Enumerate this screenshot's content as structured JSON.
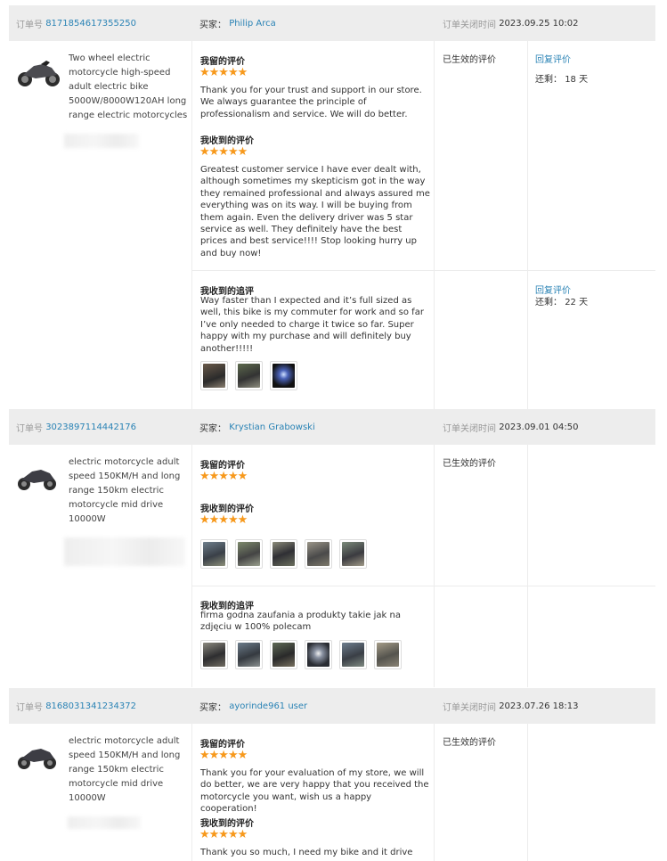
{
  "labels": {
    "order_no": "订单号",
    "buyer": "买家：",
    "closed": "订单关闭时间",
    "my_review": "我留的评价",
    "received_review": "我收到的评价",
    "received_followup": "我收到的追评",
    "effective": "已生效的评价",
    "reply": "回复评价",
    "remaining": "还剩：",
    "days": "天",
    "stars": "★★★★★"
  },
  "orders": [
    {
      "order_id": "8171854617355250",
      "buyer": "Philip Arca",
      "closed_time": "2023.09.25 10:02",
      "product": "Two wheel electric motorcycle high-speed adult electric bike 5000W/8000W120AH long range electric motorcycles",
      "my_review_text": "Thank you for your trust and support in our store. We always guarantee the principle of professionalism and service. We will do better.",
      "received_review_text": "Greatest customer service I have ever dealt with, although sometimes my skepticism got in the way they remained professional and always assured me everything was on its way. I will be buying from them again. Even the delivery driver was 5 star service as well. They definitely have the best prices and best service!!!! Stop looking hurry up and buy now!",
      "reply_days_1": "18",
      "followup_text": "Way faster than I expected and it’s full sized as well, this bike is my commuter for work and so far I’ve only needed to charge it twice so far. Super happy with my purchase and will definitely buy another!!!!!",
      "reply_days_2": "22"
    },
    {
      "order_id": "3023897114442176",
      "buyer": "Krystian Grabowski",
      "closed_time": "2023.09.01 04:50",
      "product": "electric motorcycle adult speed 150KM/H and long range 150km electric motorcycle mid drive 10000W",
      "followup_text": "firma godna zaufania a produkty takie jak na zdjęciu w 100% polecam"
    },
    {
      "order_id": "8168031341234372",
      "buyer": "ayorinde961 user",
      "closed_time": "2023.07.26 18:13",
      "product": "electric motorcycle adult speed 150KM/H and long range 150km electric motorcycle mid drive 10000W",
      "my_review_text": "Thank you for your evaluation of my store, we will do better, we are very happy that you received the motorcycle you want, wish us a happy cooperation!",
      "received_review_text": "Thank you so much, I need my bike and it drive"
    }
  ]
}
